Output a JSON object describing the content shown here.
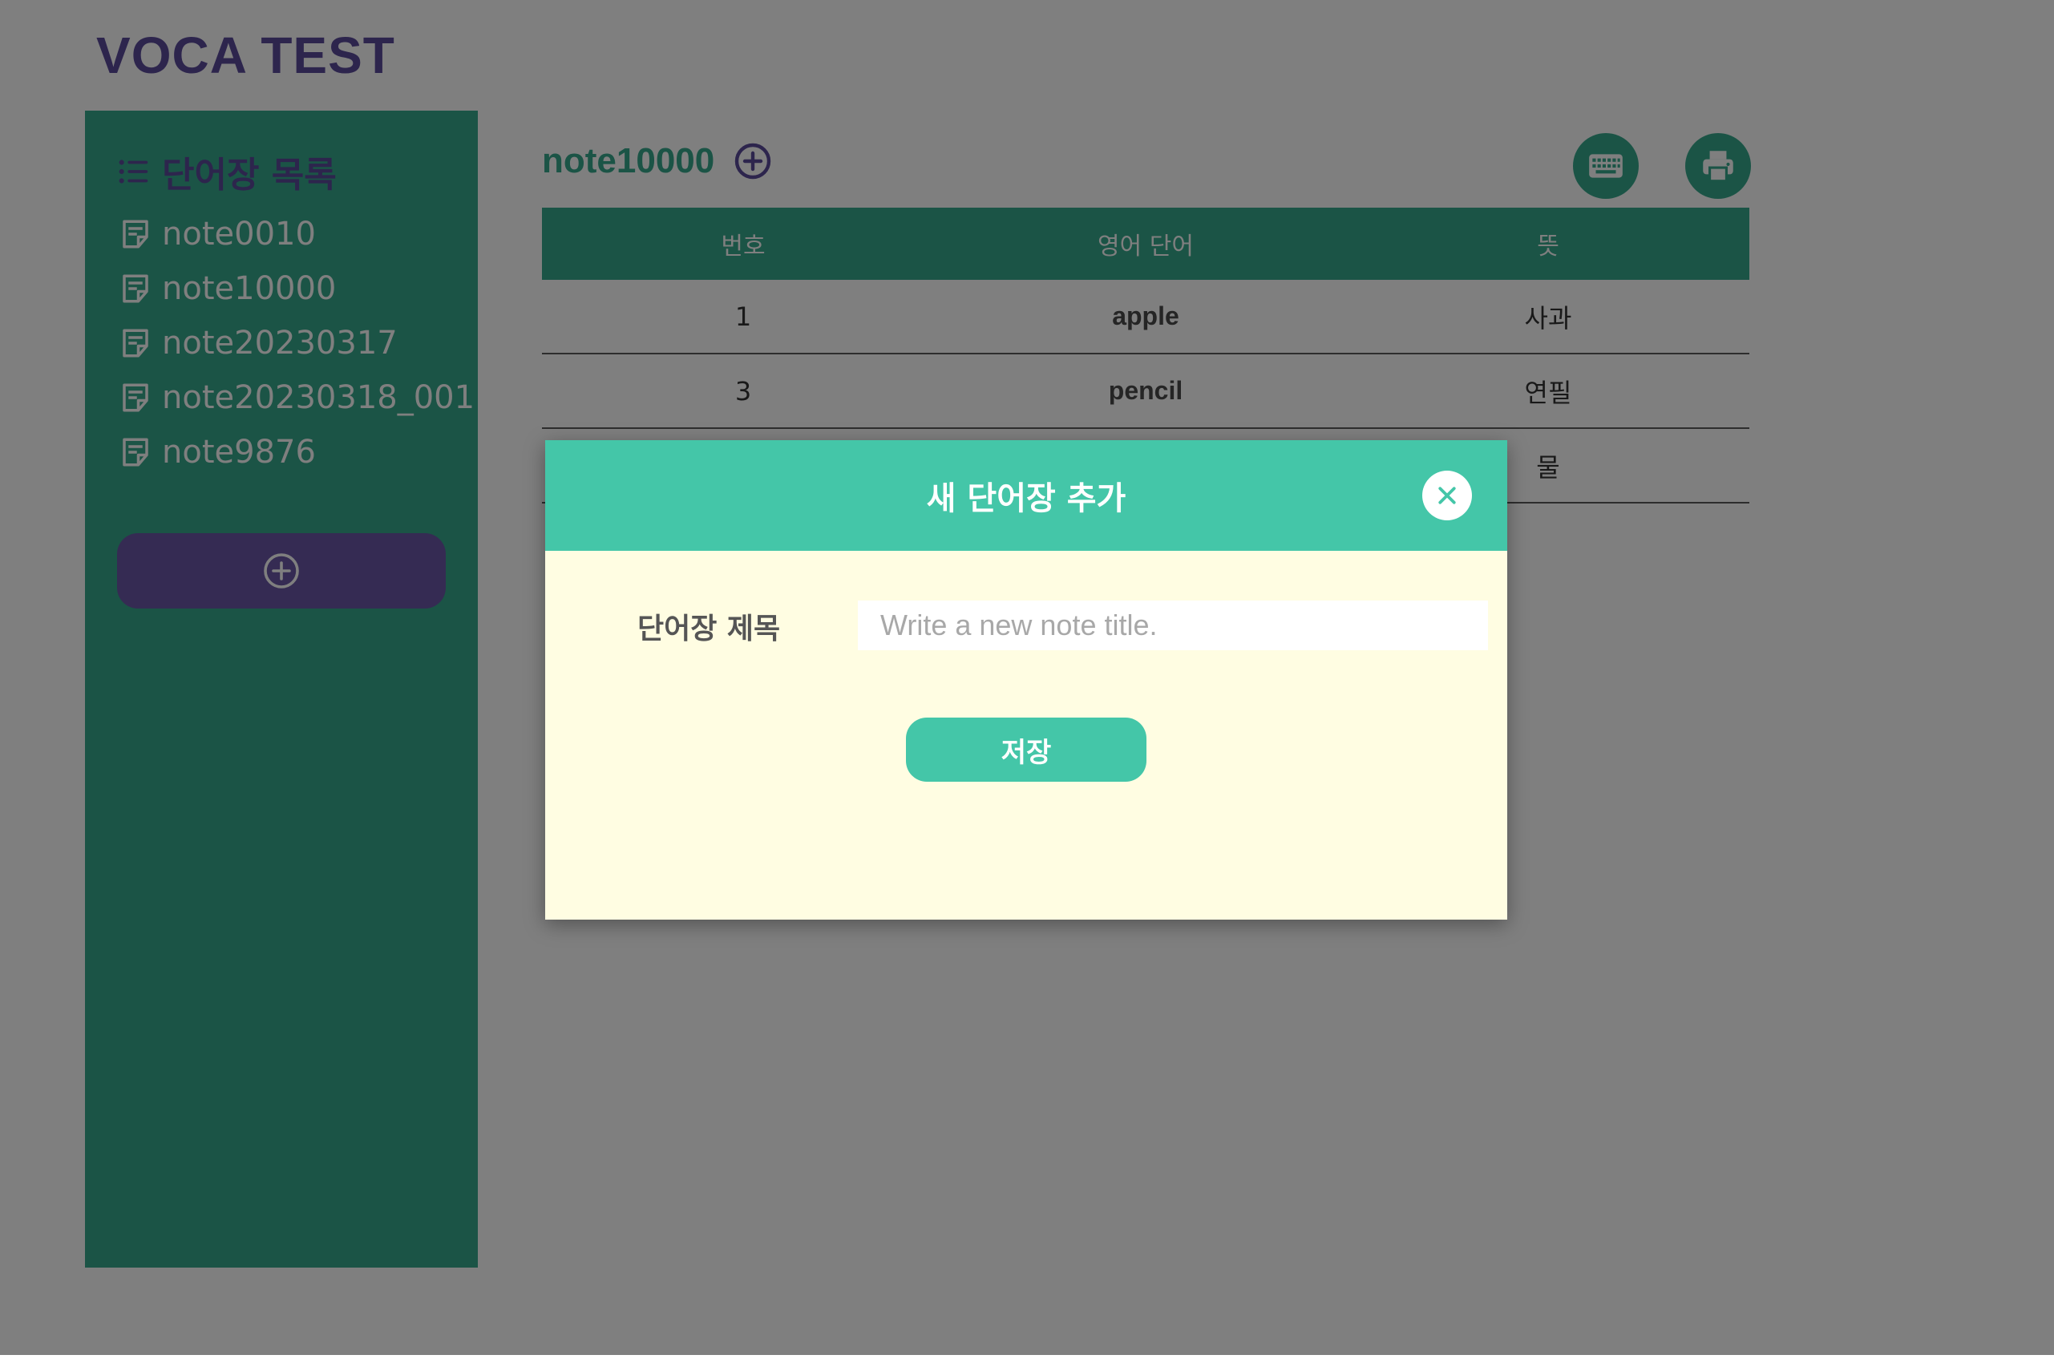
{
  "app": {
    "title": "VOCA TEST"
  },
  "sidebar": {
    "heading": "단어장 목록",
    "notes": [
      {
        "label": "note0010"
      },
      {
        "label": "note10000"
      },
      {
        "label": "note20230317"
      },
      {
        "label": "note20230318_001"
      },
      {
        "label": "note9876"
      }
    ],
    "add_icon": "plus-circle-icon"
  },
  "main": {
    "note_title": "note10000",
    "table": {
      "headers": [
        "번호",
        "영어 단어",
        "뜻"
      ],
      "rows": [
        {
          "num": "1",
          "word": "apple",
          "meaning": "사과"
        },
        {
          "num": "3",
          "word": "pencil",
          "meaning": "연필"
        },
        {
          "num": "",
          "word": "",
          "meaning": "물"
        }
      ]
    },
    "icons": [
      "keyboard-icon",
      "printer-icon"
    ]
  },
  "modal": {
    "title": "새 단어장 추가",
    "field_label": "단어장 제목",
    "input_placeholder": "Write a new note title.",
    "input_value": "",
    "save_label": "저장"
  },
  "colors": {
    "primary": "#36a88c",
    "accent": "#5a4a9a",
    "modal_header": "#44c6a8",
    "modal_body": "#fffde2"
  }
}
